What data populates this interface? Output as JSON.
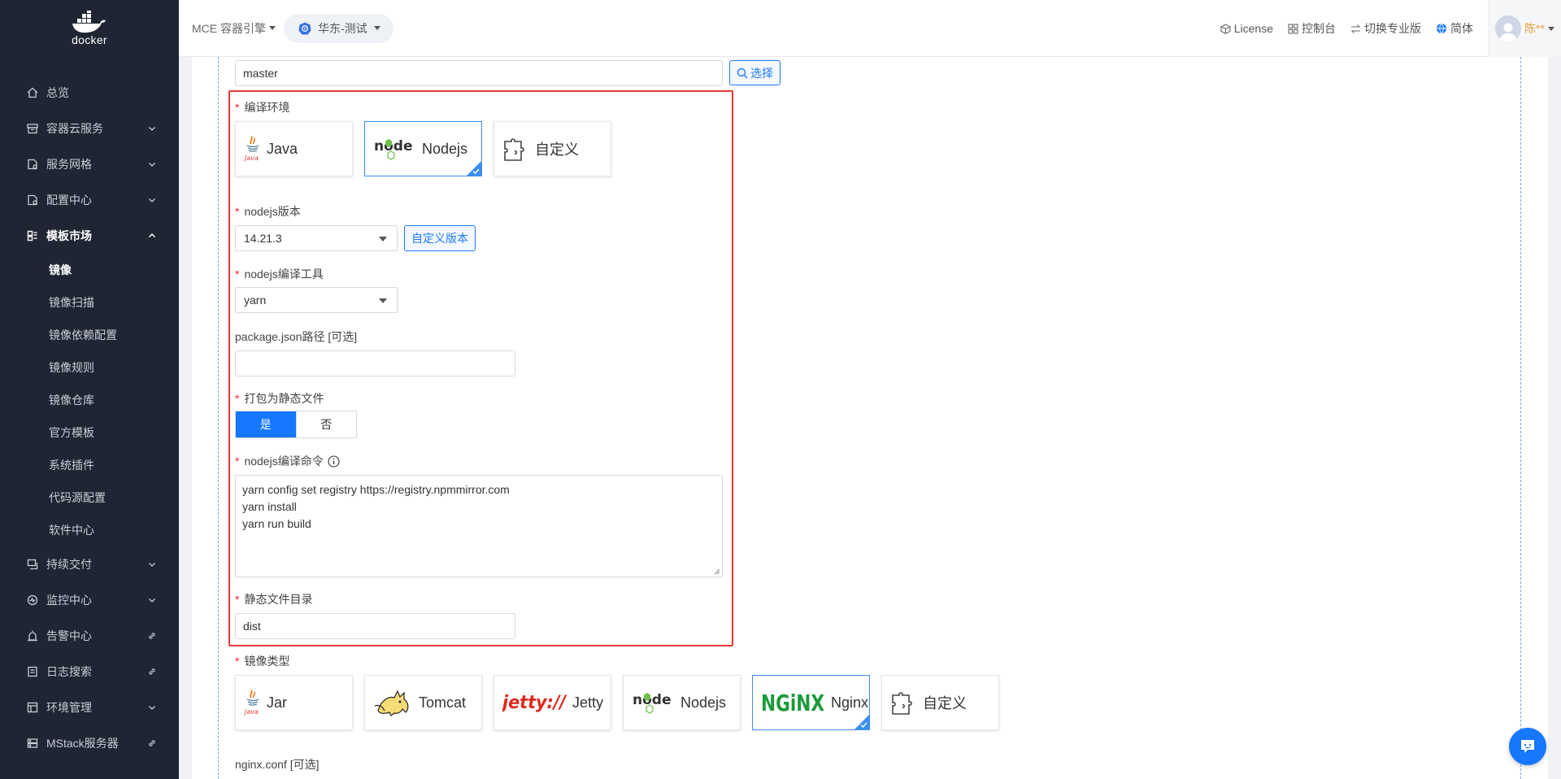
{
  "sidebar": {
    "logo_text": "docker",
    "nav": [
      {
        "label": "总览",
        "icon": "home-icon",
        "arrow": "none"
      },
      {
        "label": "容器云服务",
        "icon": "box-icon",
        "arrow": "down"
      },
      {
        "label": "服务网格",
        "icon": "mesh-icon",
        "arrow": "down"
      },
      {
        "label": "配置中心",
        "icon": "config-icon",
        "arrow": "down"
      },
      {
        "label": "模板市场",
        "icon": "template-icon",
        "arrow": "up",
        "active": true
      },
      {
        "label": "持续交付",
        "icon": "delivery-icon",
        "arrow": "down"
      },
      {
        "label": "监控中心",
        "icon": "monitor-icon",
        "arrow": "down"
      },
      {
        "label": "告警中心",
        "icon": "alarm-icon",
        "arrow": "link"
      },
      {
        "label": "日志搜索",
        "icon": "log-icon",
        "arrow": "link"
      },
      {
        "label": "环境管理",
        "icon": "env-icon",
        "arrow": "down"
      },
      {
        "label": "MStack服务器",
        "icon": "server-icon",
        "arrow": "link"
      }
    ],
    "sub_items": [
      "镜像",
      "镜像扫描",
      "镜像依赖配置",
      "镜像规则",
      "镜像仓库",
      "官方模板",
      "系统插件",
      "代码源配置",
      "软件中心"
    ]
  },
  "header": {
    "engine": "MCE 容器引擎",
    "region": "华东-测试",
    "links": [
      {
        "label": "License",
        "icon": "cube-icon"
      },
      {
        "label": "控制台",
        "icon": "grid-icon"
      },
      {
        "label": "切换专业版",
        "icon": "swap-icon"
      },
      {
        "label": "简体",
        "icon": "globe-icon"
      }
    ],
    "user": "陈**"
  },
  "form": {
    "branch_value": "master",
    "select_button": "选择",
    "build_env_label": "编译环境",
    "build_env_options": [
      "Java",
      "Nodejs",
      "自定义"
    ],
    "build_env_selected": "Nodejs",
    "node_version_label": "nodejs版本",
    "node_version_value": "14.21.3",
    "custom_version_button": "自定义版本",
    "build_tool_label": "nodejs编译工具",
    "build_tool_value": "yarn",
    "package_json_label": "package.json路径 [可选]",
    "package_json_value": "",
    "pack_static_label": "打包为静态文件",
    "pack_static_yes": "是",
    "pack_static_no": "否",
    "pack_static_selected": "是",
    "build_cmd_label": "nodejs编译命令",
    "build_cmd_lines": [
      "yarn config set registry https://registry.npmmirror.com",
      "yarn install",
      "yarn run build"
    ],
    "static_dir_label": "静态文件目录",
    "static_dir_value": "dist",
    "image_type_label": "镜像类型",
    "image_type_options": [
      "Jar",
      "Tomcat",
      "Jetty",
      "Nodejs",
      "Nginx",
      "自定义"
    ],
    "image_type_selected": "Nginx",
    "nginx_conf_label": "nginx.conf [可选]",
    "jetty_logo_text": "jetty://",
    "nginx_logo_text": "NGiNX",
    "node_logo_text": "node",
    "java_logo_text": "Java"
  },
  "colors": {
    "sidebar_bg": "#1f2532",
    "accent": "#1677ff",
    "highlight_box": "#e53935",
    "required": "#f5222d"
  }
}
